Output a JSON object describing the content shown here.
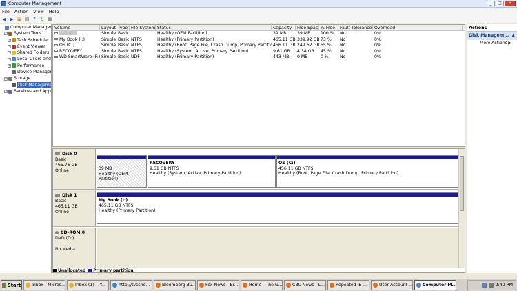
{
  "window": {
    "title": "Computer Management"
  },
  "menu": [
    "File",
    "Action",
    "View",
    "Help"
  ],
  "toolbar": [
    "back-icon",
    "forward-icon",
    "up-icon",
    "properties-icon",
    "help-icon",
    "refresh-icon",
    "settings-icon"
  ],
  "tree": {
    "items": [
      {
        "label": "Computer Managem",
        "level": 0,
        "exp": "",
        "icon": "computer-icon"
      },
      {
        "label": "System Tools",
        "level": 1,
        "exp": "−",
        "icon": "tools-icon"
      },
      {
        "label": "Task Scheduler",
        "level": 2,
        "exp": "+",
        "icon": "clock-icon"
      },
      {
        "label": "Event Viewer",
        "level": 2,
        "exp": "+",
        "icon": "log-icon"
      },
      {
        "label": "Shared Folders",
        "level": 2,
        "exp": "+",
        "icon": "folder-icon"
      },
      {
        "label": "Local Users and G",
        "level": 2,
        "exp": "+",
        "icon": "users-icon"
      },
      {
        "label": "Performance",
        "level": 2,
        "exp": "+",
        "icon": "chart-icon"
      },
      {
        "label": "Device Manager",
        "level": 2,
        "exp": "",
        "icon": "device-icon"
      },
      {
        "label": "Storage",
        "level": 1,
        "exp": "−",
        "icon": "storage-icon"
      },
      {
        "label": "Disk Managemer",
        "level": 2,
        "exp": "",
        "icon": "disk-icon",
        "selected": true
      },
      {
        "label": "Services and Applic",
        "level": 1,
        "exp": "+",
        "icon": "services-icon"
      }
    ]
  },
  "volumes": {
    "headers": [
      "Volume",
      "Layout",
      "Type",
      "File System",
      "Status",
      "Capacity",
      "Free Space",
      "% Free",
      "Fault Tolerance",
      "Overhead"
    ],
    "rows": [
      [
        "",
        "Simple",
        "Basic",
        "",
        "Healthy (OEM Partition)",
        "39 MB",
        "39 MB",
        "100 %",
        "No",
        "0%"
      ],
      [
        "My Book (I:)",
        "Simple",
        "Basic",
        "NTFS",
        "Healthy (Primary Partition)",
        "465.11 GB",
        "339.92 GB",
        "73 %",
        "No",
        "0%"
      ],
      [
        "OS (C:)",
        "Simple",
        "Basic",
        "NTFS",
        "Healthy (Boot, Page File, Crash Dump, Primary Partition)",
        "456.11 GB",
        "249.62 GB",
        "55 %",
        "No",
        "0%"
      ],
      [
        "RECOVERY",
        "Simple",
        "Basic",
        "NTFS",
        "Healthy (System, Active, Primary Partition)",
        "9.61 GB",
        "4.34 GB",
        "45 %",
        "No",
        "0%"
      ],
      [
        "WD SmartWare (F:)",
        "Simple",
        "Basic",
        "UDF",
        "Healthy (Primary Partition)",
        "443 MB",
        "0 MB",
        "0 %",
        "No",
        "0%"
      ]
    ]
  },
  "disks": {
    "disk0": {
      "name": "Disk 0",
      "type": "Basic",
      "size": "465.76 GB",
      "state": "Online",
      "p1": {
        "size": "39 MB",
        "status": "Healthy (OEM Partition)"
      },
      "p2": {
        "name": "RECOVERY",
        "size": "9.61 GB NTFS",
        "status": "Healthy (System, Active, Primary Partition)"
      },
      "p3": {
        "name": "OS  (C:)",
        "size": "456.11 GB NTFS",
        "status": "Healthy (Boot, Page File, Crash Dump, Primary Partition)"
      }
    },
    "disk1": {
      "name": "Disk 1",
      "type": "Basic",
      "size": "465.11 GB",
      "state": "Online",
      "p1": {
        "name": "My Book  (I:)",
        "size": "465.11 GB NTFS",
        "status": "Healthy (Primary Partition)"
      }
    },
    "cdrom0": {
      "name": "CD-ROM 0",
      "type": "DVD (D:)",
      "state": "No Media"
    }
  },
  "legend": {
    "unallocated": "Unallocated",
    "primary": "Primary partition",
    "unallocated_color": "#000000",
    "primary_color": "#1c1c8c"
  },
  "actions": {
    "title": "Actions",
    "section": "Disk Managem...",
    "more": "More Actions"
  },
  "taskbar": {
    "start": "Start",
    "buttons": [
      {
        "label": "Inbox - Micros...",
        "color": "#e8b23a"
      },
      {
        "label": "Inbox (1) - 'Y...",
        "color": "#e8b23a"
      },
      {
        "label": "http://tvsche...",
        "color": "#3a7fd0"
      },
      {
        "label": "Bloomberg Bu...",
        "color": "#e06a1e"
      },
      {
        "label": "Fox News - Br...",
        "color": "#e06a1e"
      },
      {
        "label": "Home - The G...",
        "color": "#e06a1e"
      },
      {
        "label": "CBC News - L...",
        "color": "#e06a1e"
      },
      {
        "label": "Repeated IE ...",
        "color": "#e06a1e"
      },
      {
        "label": "User Account ...",
        "color": "#e06a1e"
      },
      {
        "label": "Computer M...",
        "color": "#5b7fb0",
        "active": true
      }
    ],
    "clock": "2:49 PM"
  }
}
